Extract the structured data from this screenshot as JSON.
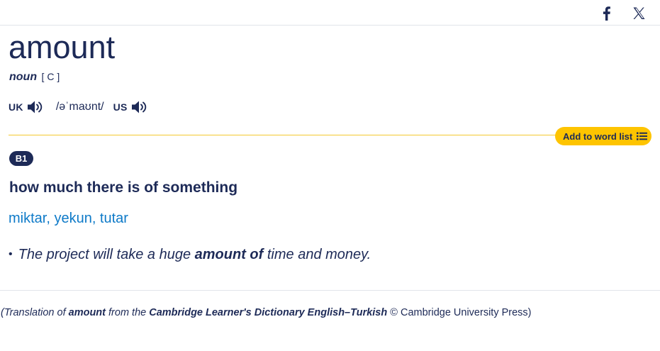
{
  "share": {
    "facebook_icon": "facebook-icon",
    "x_icon": "x-twitter-icon"
  },
  "entry": {
    "headword": "amount",
    "pos": "noun",
    "grammar": "[ C ]",
    "pron": {
      "uk_label": "UK",
      "ipa": "/əˈmaʊnt/",
      "us_label": "US",
      "audio_icon": "speaker-icon"
    },
    "add_to_word_list": "Add to word list",
    "sense": {
      "level": "B1",
      "definition": "how much there is of something",
      "translation": "miktar, yekun, tutar",
      "example": {
        "bullet": "•",
        "before": "The project will take a huge",
        "highlight": "amount of",
        "after": "time and money."
      }
    }
  },
  "footer": {
    "open": "(Translation of",
    "word": "amount",
    "from": "from the",
    "dictionary": "Cambridge Learner's Dictionary English–Turkish",
    "copyright": "© Cambridge University Press)"
  },
  "colors": {
    "navy": "#1d2a57",
    "translation_blue": "#0e7ac8",
    "accent_yellow": "#fec400"
  }
}
